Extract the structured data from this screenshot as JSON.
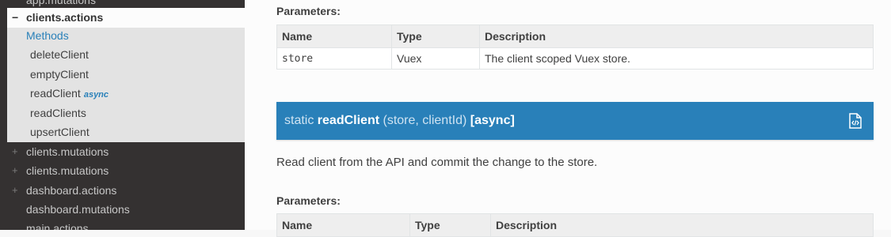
{
  "sidebar": {
    "top_partial": "app.mutations",
    "active_section": {
      "toggle": "−",
      "label": "clients.actions"
    },
    "methods_link": "Methods",
    "methods": [
      {
        "label": "deleteClient",
        "tag": ""
      },
      {
        "label": "emptyClient",
        "tag": ""
      },
      {
        "label": "readClient",
        "tag": "async"
      },
      {
        "label": "readClients",
        "tag": ""
      },
      {
        "label": "upsertClient",
        "tag": ""
      }
    ],
    "items": [
      {
        "toggle": "+",
        "label": "clients.mutations"
      },
      {
        "toggle": "+",
        "label": "clients.mutations"
      },
      {
        "toggle": "+",
        "label": "dashboard.actions"
      },
      {
        "toggle": "",
        "label": "dashboard.mutations"
      },
      {
        "toggle": "",
        "label": "main.actions"
      }
    ]
  },
  "main": {
    "params_title_1": "Parameters:",
    "table1": {
      "headers": [
        "Name",
        "Type",
        "Description"
      ],
      "rows": [
        {
          "name": "store",
          "type": "Vuex",
          "description": "The client scoped Vuex store."
        }
      ]
    },
    "method": {
      "static_label": "static",
      "name": "readClient",
      "args": "(store, clientId)",
      "async": "[async]",
      "icon": "view-source-icon"
    },
    "method_description": "Read client from the API and commit the change to the store.",
    "params_title_2": "Parameters:",
    "table2": {
      "headers": [
        "Name",
        "Type",
        "Description"
      ]
    }
  }
}
